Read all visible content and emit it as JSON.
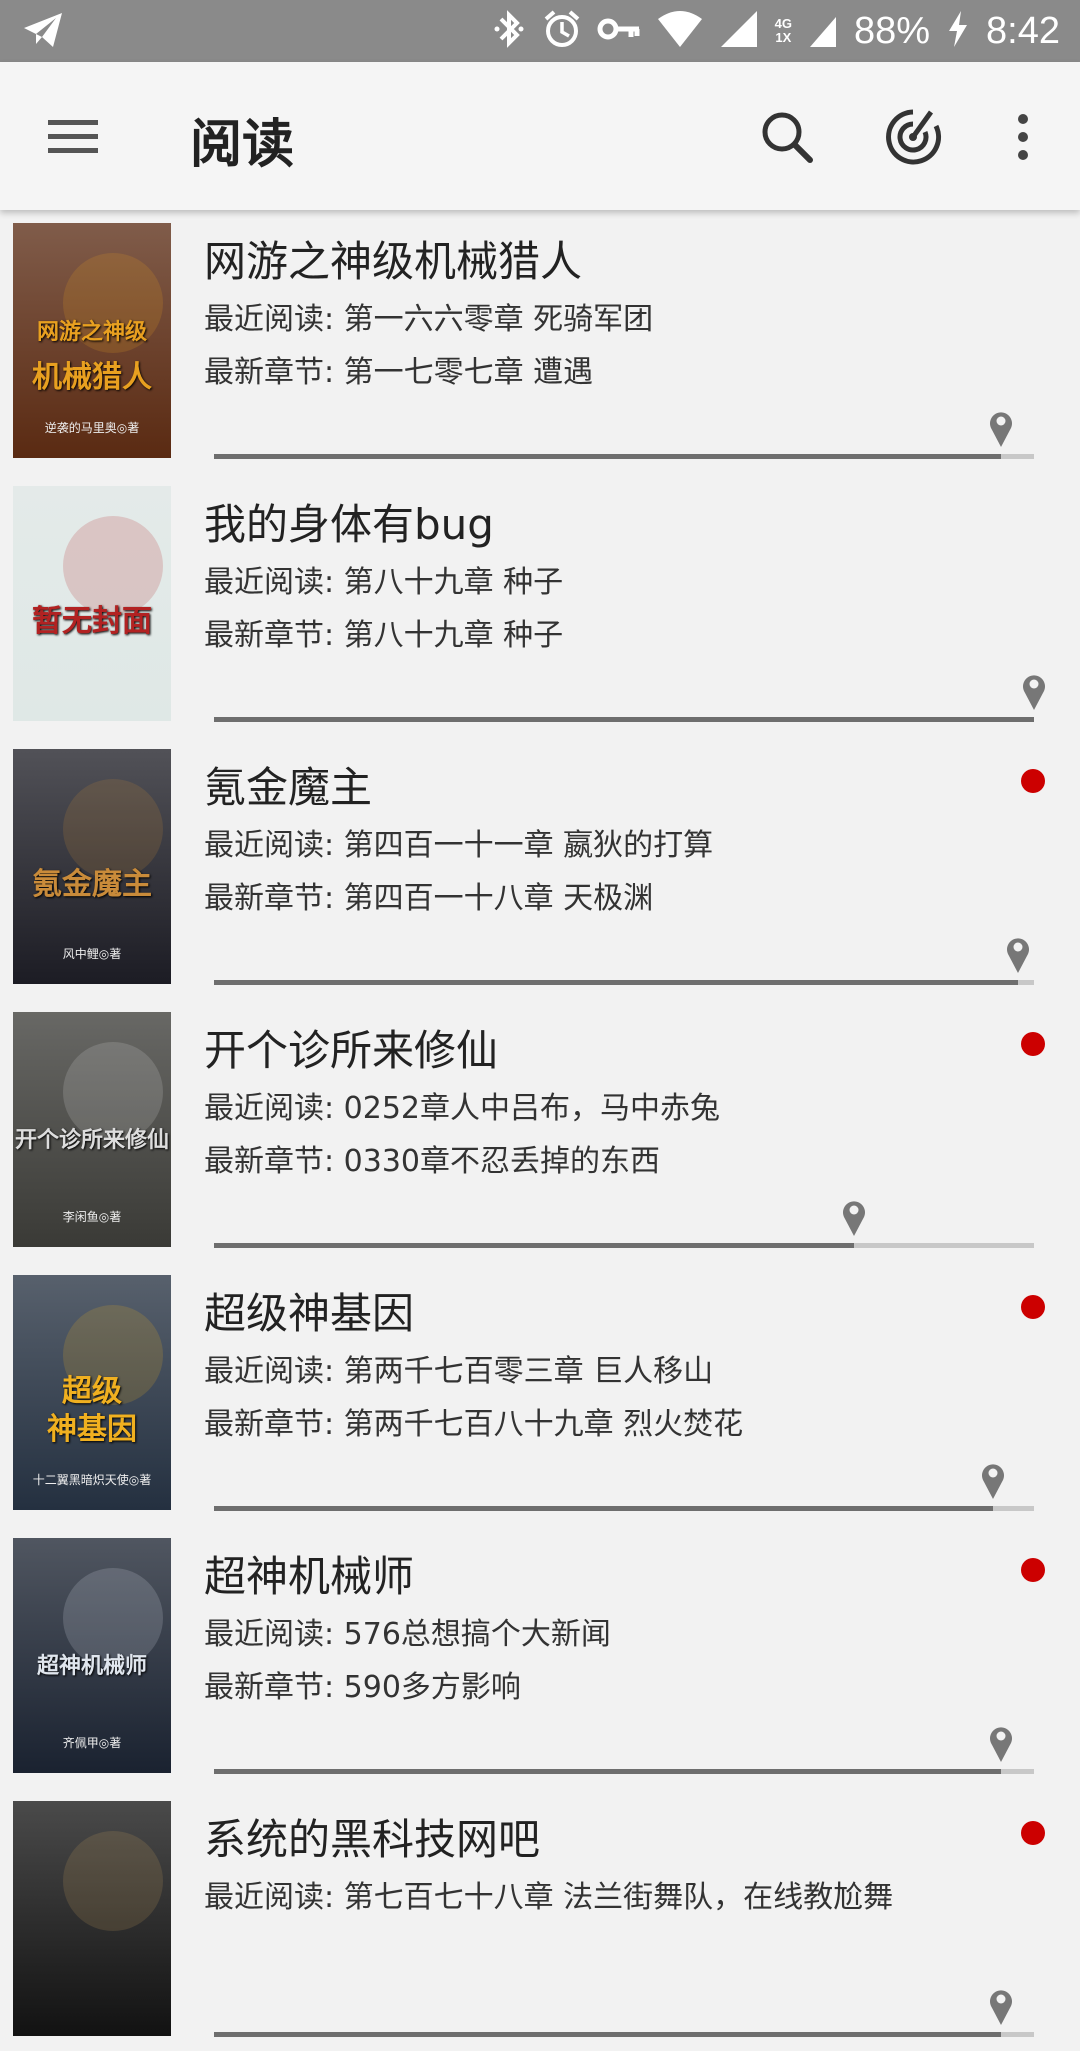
{
  "status_bar": {
    "battery_text": "88%",
    "time": "8:42",
    "network_badge_top": "4G",
    "network_badge_bottom": "1X",
    "icons": [
      "telegram-icon",
      "bluetooth-icon",
      "alarm-icon",
      "vpn-key-icon",
      "wifi-icon",
      "signal-icon",
      "charging-icon"
    ]
  },
  "app_bar": {
    "title": "阅读",
    "icons": [
      "menu-icon",
      "search-icon",
      "radar-icon",
      "more-vert-icon"
    ]
  },
  "colors": {
    "status_bar_bg": "#8a8a8a",
    "app_bar_bg": "#f5f5f5",
    "page_bg": "#f2f2f2",
    "new_dot": "#cc0000",
    "progress_fill": "#6e6e6e",
    "progress_track": "#c8c8c8"
  },
  "books": [
    {
      "title": "网游之神级机械猎人",
      "recent": "最近阅读: 第一六六零章 死骑军团",
      "latest": "最新章节: 第一七零七章 遭遇",
      "has_update": false,
      "progress": 0.96,
      "cover": {
        "lines": [
          "网游之神级",
          "机械猎人"
        ],
        "sub": "逆袭的马里奥◎著",
        "bg": "#5a2a12",
        "accent": "#e8a020"
      }
    },
    {
      "title": "我的身体有bug",
      "recent": "最近阅读: 第八十九章 种子",
      "latest": "最新章节: 第八十九章 种子",
      "has_update": false,
      "progress": 1.0,
      "cover": {
        "lines": [
          "暂无封面"
        ],
        "sub": "",
        "bg": "#dfe8e6",
        "accent": "#b22222"
      }
    },
    {
      "title": "氪金魔主",
      "recent": "最近阅读: 第四百一十一章 嬴狄的打算",
      "latest": "最新章节: 第四百一十八章 天极渊",
      "has_update": true,
      "progress": 0.98,
      "cover": {
        "lines": [
          "氪金魔主"
        ],
        "sub": "风中鲤◎著",
        "bg": "#1c1c24",
        "accent": "#c98b3a"
      }
    },
    {
      "title": "开个诊所来修仙",
      "recent": "最近阅读: 0252章人中吕布，马中赤兔",
      "latest": "最新章节: 0330章不忍丢掉的东西",
      "has_update": true,
      "progress": 0.78,
      "cover": {
        "lines": [
          "开个诊所来修仙"
        ],
        "sub": "李闲鱼◎著",
        "bg": "#3a3a36",
        "accent": "#dddddd"
      }
    },
    {
      "title": "超级神基因",
      "recent": "最近阅读: 第两千七百零三章 巨人移山",
      "latest": "最新章节: 第两千七百八十九章 烈火焚花",
      "has_update": true,
      "progress": 0.95,
      "cover": {
        "lines": [
          "超级",
          "神基因"
        ],
        "sub": "十二翼黑暗炽天使◎著",
        "bg": "#243040",
        "accent": "#f0b020"
      }
    },
    {
      "title": "超神机械师",
      "recent": "最近阅读: 576总想搞个大新闻",
      "latest": "最新章节: 590多方影响",
      "has_update": true,
      "progress": 0.96,
      "cover": {
        "lines": [
          "超神机械师"
        ],
        "sub": "齐佩甲◎著",
        "bg": "#1a2230",
        "accent": "#e0e6ee"
      }
    },
    {
      "title": "系统的黑科技网吧",
      "recent": "最近阅读: 第七百七十八章 法兰街舞队，在线教尬舞",
      "latest": "",
      "has_update": true,
      "progress": 0.96,
      "cover": {
        "lines": [
          ""
        ],
        "sub": "",
        "bg": "#121212",
        "accent": "#c9a060"
      }
    }
  ]
}
